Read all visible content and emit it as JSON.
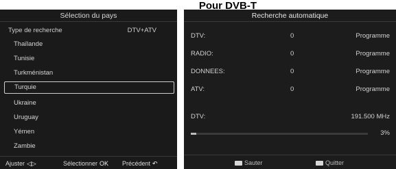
{
  "page": {
    "title": "Pour DVB-T"
  },
  "left": {
    "header": "Sélection du pays",
    "mode_label": "Type de recherche",
    "mode_value": "DTV+ATV",
    "countries": [
      {
        "label": "Thaïlande",
        "selected": false
      },
      {
        "label": "Tunisie",
        "selected": false
      },
      {
        "label": "Turkménistan",
        "selected": false
      },
      {
        "label": "Turquie",
        "selected": true
      },
      {
        "label": "Ukraine",
        "selected": false
      },
      {
        "label": "Uruguay",
        "selected": false
      },
      {
        "label": "Yémen",
        "selected": false
      },
      {
        "label": "Zambie",
        "selected": false
      }
    ],
    "footer": {
      "adjust_label": "Ajuster",
      "adjust_icon": "left-right-arrows-icon",
      "select_label": "Sélectionner",
      "select_icon": "ok-icon",
      "previous_label": "Précédent",
      "previous_icon": "back-arrow-icon"
    }
  },
  "right": {
    "header": "Recherche automatique",
    "counts": [
      {
        "label": "DTV:",
        "count": "0",
        "unit": "Programme"
      },
      {
        "label": "RADIO:",
        "count": "0",
        "unit": "Programme"
      },
      {
        "label": "DONNEES:",
        "count": "0",
        "unit": "Programme"
      },
      {
        "label": "ATV:",
        "count": "0",
        "unit": "Programme"
      }
    ],
    "dtv_label": "DTV:",
    "frequency": "191.500 MHz",
    "progress_text": "3%",
    "progress_fraction": 0.03,
    "footer": {
      "skip_label": "Sauter",
      "quit_label": "Quitter"
    }
  }
}
